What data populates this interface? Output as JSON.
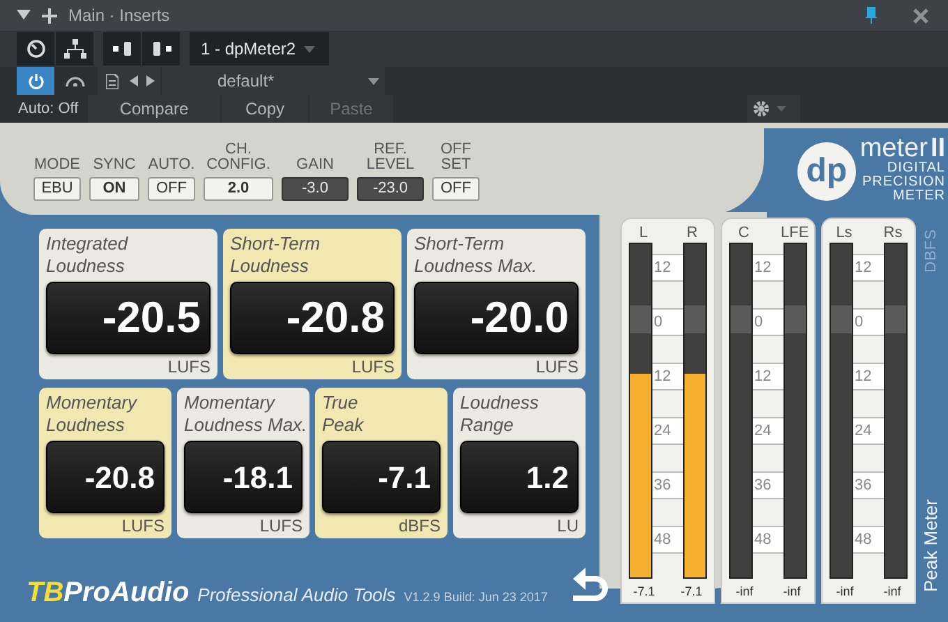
{
  "title_bar": {
    "title": "Main · Inserts"
  },
  "toolbar": {
    "plugin": "1 - dpMeter2",
    "power_on": true,
    "preset": "default*",
    "automation": "Auto: Off",
    "buttons": [
      {
        "label": "Compare",
        "disabled": false
      },
      {
        "label": "Copy",
        "disabled": false
      },
      {
        "label": "Paste",
        "disabled": true
      }
    ]
  },
  "settings": [
    {
      "label": [
        "MODE"
      ],
      "value": "EBU",
      "kind": "toggle"
    },
    {
      "label": [
        "SYNC"
      ],
      "value": "ON",
      "kind": "toggle"
    },
    {
      "label": [
        "AUTO."
      ],
      "value": "OFF",
      "kind": "toggle"
    },
    {
      "label": [
        "CH.",
        "CONFIG."
      ],
      "value": "2.0",
      "kind": "toggle"
    },
    {
      "label": [
        "GAIN"
      ],
      "value": "-3.0",
      "kind": "display"
    },
    {
      "label": [
        "REF.",
        "LEVEL"
      ],
      "value": "-23.0",
      "kind": "display"
    },
    {
      "label": [
        "OFF",
        "SET"
      ],
      "value": "OFF",
      "kind": "toggle"
    }
  ],
  "logo": {
    "mark": "dp",
    "name": "meter",
    "suffix": "II",
    "tagline": [
      "DIGITAL",
      "PRECISION",
      "METER"
    ]
  },
  "readouts": [
    {
      "label": [
        "Integrated",
        "Loudness"
      ],
      "value": "-20.5",
      "unit": "LUFS",
      "highlighted": false
    },
    {
      "label": [
        "Short-Term",
        "Loudness"
      ],
      "value": "-20.8",
      "unit": "LUFS",
      "highlighted": true
    },
    {
      "label": [
        "Short-Term",
        "Loudness Max."
      ],
      "value": "-20.0",
      "unit": "LUFS",
      "highlighted": false
    },
    {
      "label": [
        "Momentary",
        "Loudness"
      ],
      "value": "-20.8",
      "unit": "LUFS",
      "highlighted": true
    },
    {
      "label": [
        "Momentary",
        "Loudness Max."
      ],
      "value": "-18.1",
      "unit": "LUFS",
      "highlighted": false
    },
    {
      "label": [
        "True",
        "Peak"
      ],
      "value": "-7.1",
      "unit": "dBFS",
      "highlighted": true
    },
    {
      "label": [
        "Loudness",
        "Range"
      ],
      "value": "1.2",
      "unit": "LU",
      "highlighted": false
    }
  ],
  "meter_groups": [
    {
      "channels": [
        {
          "name": "L",
          "level": 0.61,
          "reading": "-7.1"
        },
        {
          "name": "R",
          "level": 0.61,
          "reading": "-7.1"
        }
      ],
      "scale": [
        "12",
        "0",
        "12",
        "24",
        "36",
        "48"
      ]
    },
    {
      "channels": [
        {
          "name": "C",
          "level": 0,
          "reading": "-inf"
        },
        {
          "name": "LFE",
          "level": 0,
          "reading": "-inf"
        }
      ],
      "scale": [
        "12",
        "0",
        "12",
        "24",
        "36",
        "48"
      ]
    },
    {
      "channels": [
        {
          "name": "Ls",
          "level": 0,
          "reading": "-inf"
        },
        {
          "name": "Rs",
          "level": 0,
          "reading": "-inf"
        }
      ],
      "scale": [
        "12",
        "0",
        "12",
        "24",
        "36",
        "48"
      ]
    }
  ],
  "side_labels": {
    "scale_unit": "DBFS",
    "mode": "Peak Meter"
  },
  "footer": {
    "brand_prefix": "TB",
    "brand_name": "ProAudio",
    "tagline": "Professional Audio Tools",
    "version": "V1.2.9 Build: Jun 23 2017"
  }
}
